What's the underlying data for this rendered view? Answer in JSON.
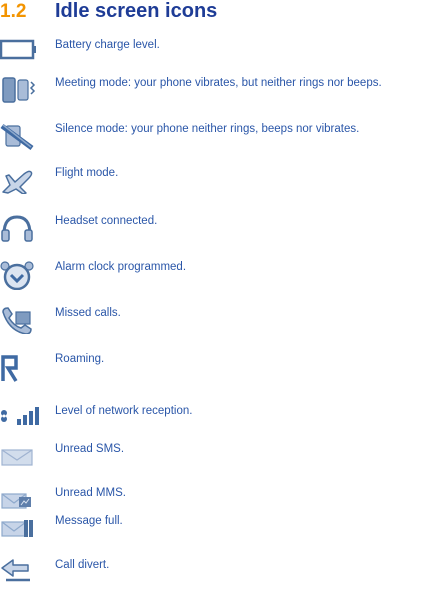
{
  "section": {
    "number": "1.2",
    "title": "Idle screen icons"
  },
  "icons": [
    {
      "icon": "battery-icon",
      "text": "Battery charge level."
    },
    {
      "icon": "meeting-mode-icon",
      "text": "Meeting mode: your phone vibrates, but neither rings nor beeps."
    },
    {
      "icon": "silence-mode-icon",
      "text": "Silence mode: your phone neither rings, beeps nor vibrates."
    },
    {
      "icon": "flight-mode-icon",
      "text": "Flight mode."
    },
    {
      "icon": "headset-icon",
      "text": "Headset connected."
    },
    {
      "icon": "alarm-clock-icon",
      "text": "Alarm clock programmed."
    },
    {
      "icon": "missed-calls-icon",
      "text": "Missed calls."
    },
    {
      "icon": "roaming-icon",
      "text": "Roaming."
    },
    {
      "icon": "network-signal-icon",
      "text": "Level of network reception."
    },
    {
      "icon": "unread-sms-icon",
      "text": "Unread SMS."
    },
    {
      "icon": "unread-mms-icon",
      "text": "Unread MMS."
    },
    {
      "icon": "message-full-icon",
      "text": "Message full."
    },
    {
      "icon": "call-divert-icon",
      "text": "Call divert."
    }
  ],
  "colors": {
    "number": "#f39400",
    "title": "#1e3c96",
    "text": "#2a56a8",
    "icon": "#4a6f9e"
  }
}
